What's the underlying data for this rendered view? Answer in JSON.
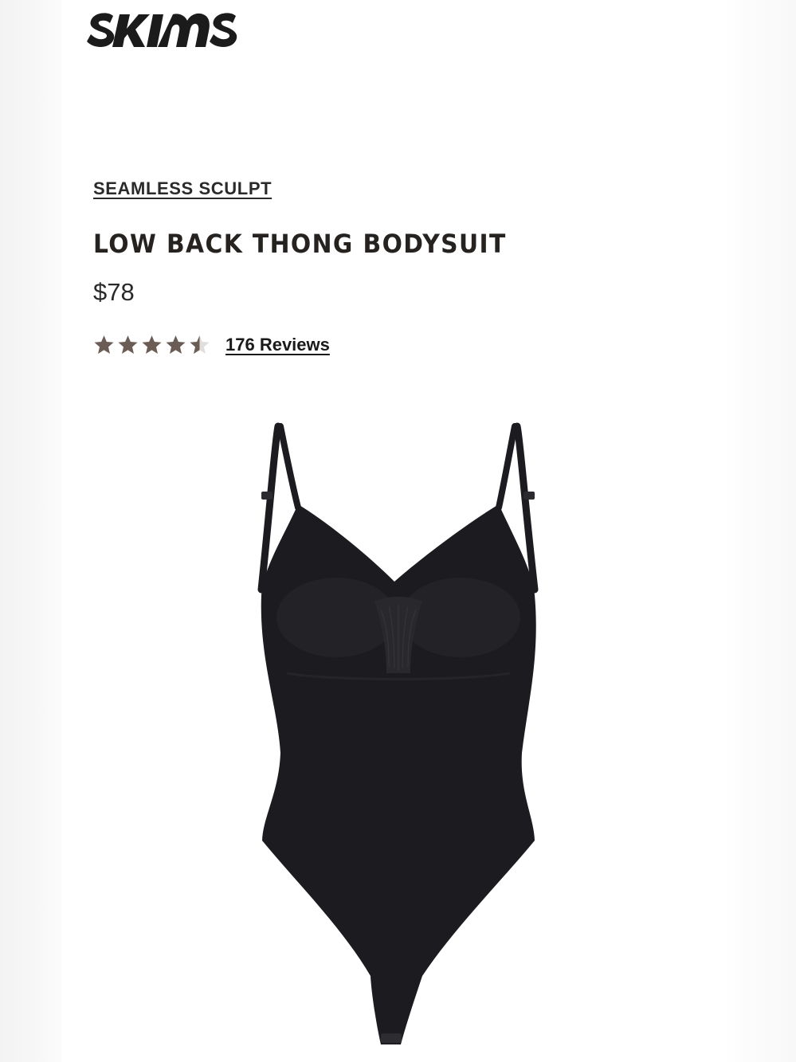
{
  "brand": {
    "logo_text": "SKIMS"
  },
  "product": {
    "collection": "SEAMLESS SCULPT",
    "title": "LOW BACK THONG BODYSUIT",
    "price": "$78",
    "rating": {
      "value": 4.5,
      "max": 5,
      "reviews_label": "176 Reviews"
    },
    "color_name": "black",
    "image_subject": "bodysuit"
  },
  "colors": {
    "star_fill": "#6b5d56",
    "star_empty": "#e2dedc",
    "text": "#222222",
    "product": "#1c1b1f"
  },
  "icons": {
    "star": "star-icon",
    "half_star": "half-star-icon"
  }
}
